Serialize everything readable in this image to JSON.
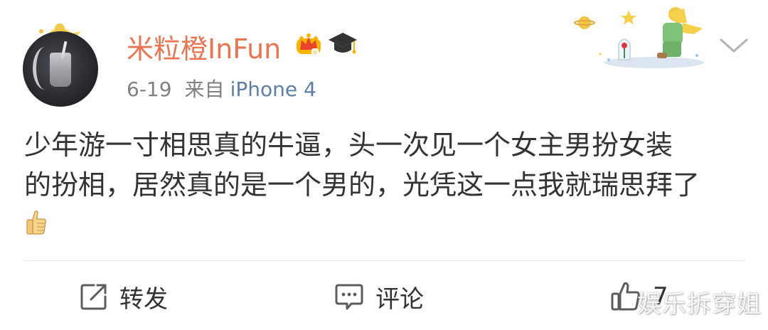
{
  "post": {
    "username": "米粒橙InFun",
    "time": "6-19",
    "from_label": "来自",
    "source": "iPhone 4",
    "content_lines": [
      "少年游一寸相思真的牛逼，头一次见一个女主男扮女装",
      "的扮相，居然真的是一个男的，光凭这一点我就瑞思拜了"
    ]
  },
  "actions": {
    "repost_label": "转发",
    "comment_label": "评论",
    "like_count": "7"
  },
  "icons": {
    "crown_badge": "vip-crown-icon",
    "cap_badge": "graduation-cap-icon",
    "chevron": "chevron-down-icon",
    "emoji": "thumbs-up-emoji",
    "repost": "repost-icon",
    "comment": "comment-icon",
    "like": "like-thumb-icon"
  },
  "colors": {
    "username": "#eb7350",
    "source": "#5d7fa6",
    "meta": "#808080",
    "text": "#333333",
    "divider": "#e6e6e6"
  },
  "watermark": "娱乐拆穿姐"
}
